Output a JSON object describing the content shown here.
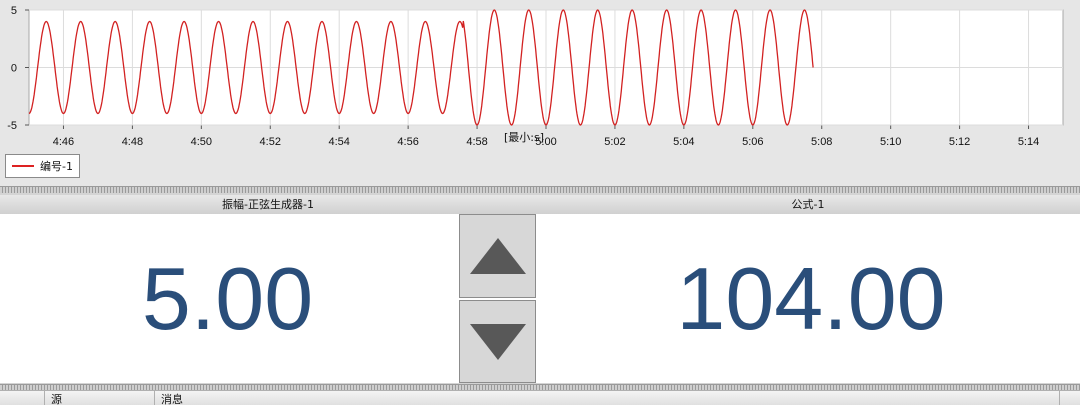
{
  "chart_data": {
    "type": "line",
    "series": [
      {
        "name": "编号-1",
        "color": "#d22222",
        "x_start": "4:45:00",
        "x_end": "5:07:45",
        "amplitude_segments": [
          {
            "from": "4:45:00",
            "to": "4:57:35",
            "amplitude": 4
          },
          {
            "from": "4:57:35",
            "to": "5:07:45",
            "amplitude": 5
          }
        ],
        "period_seconds": 60
      }
    ],
    "x_ticks": [
      "4:46",
      "4:48",
      "4:50",
      "4:52",
      "4:54",
      "4:56",
      "4:58",
      "5:00",
      "5:02",
      "5:04",
      "5:06",
      "5:08",
      "5:10",
      "5:12",
      "5:14"
    ],
    "xlim": [
      "4:45:00",
      "5:15:00"
    ],
    "y_ticks": [
      5,
      0,
      -5
    ],
    "ylim": [
      -5,
      5
    ],
    "unit_label": "[最小:s]",
    "grid": true,
    "legend": "bottom-left"
  },
  "legend": {
    "label": "编号-1",
    "color": "#d22222"
  },
  "displays": {
    "left": {
      "header": "振幅-正弦生成器-1",
      "value": "5.00"
    },
    "right": {
      "header": "公式-1",
      "value": "104.00"
    }
  },
  "buttons": {
    "up_icon": "triangle-up-icon",
    "down_icon": "triangle-down-icon"
  },
  "message_list": {
    "columns": [
      "源",
      "消息"
    ]
  },
  "colors": {
    "value_text": "#2a4e7a",
    "trace": "#d22222",
    "button_face": "#d7d7d7"
  }
}
